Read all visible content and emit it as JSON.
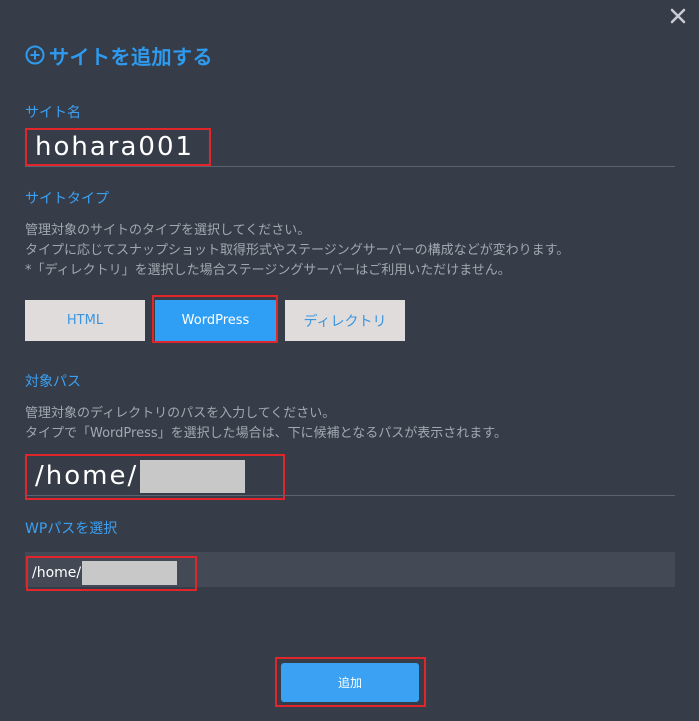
{
  "dialog": {
    "title": "サイトを追加する",
    "close_icon": "close-icon"
  },
  "site_name": {
    "label": "サイト名",
    "value": "hohara001"
  },
  "site_type": {
    "label": "サイトタイプ",
    "description_lines": [
      "管理対象のサイトのタイプを選択してください。",
      "タイプに応じてスナップショット取得形式やステージングサーバーの構成などが変わります。",
      "*「ディレクトリ」を選択した場合ステージングサーバーはご利用いただけません。"
    ],
    "options": [
      {
        "label": "HTML",
        "selected": false
      },
      {
        "label": "WordPress",
        "selected": true
      },
      {
        "label": "ディレクトリ",
        "selected": false
      }
    ]
  },
  "target_path": {
    "label": "対象パス",
    "description_lines": [
      "管理対象のディレクトリのパスを入力してください。",
      "タイプで「WordPress」を選択した場合は、下に候補となるパスが表示されます。"
    ],
    "value": "/home/"
  },
  "wp_path": {
    "label": "WPパスを選択",
    "candidate": "/home/"
  },
  "submit": {
    "label": "追加"
  },
  "colors": {
    "background": "#363d48",
    "accent": "#2e9bf0",
    "highlight_border": "#e0262a",
    "selected_button": "#2f9ff6",
    "unselected_button": "#e0dcdc"
  }
}
